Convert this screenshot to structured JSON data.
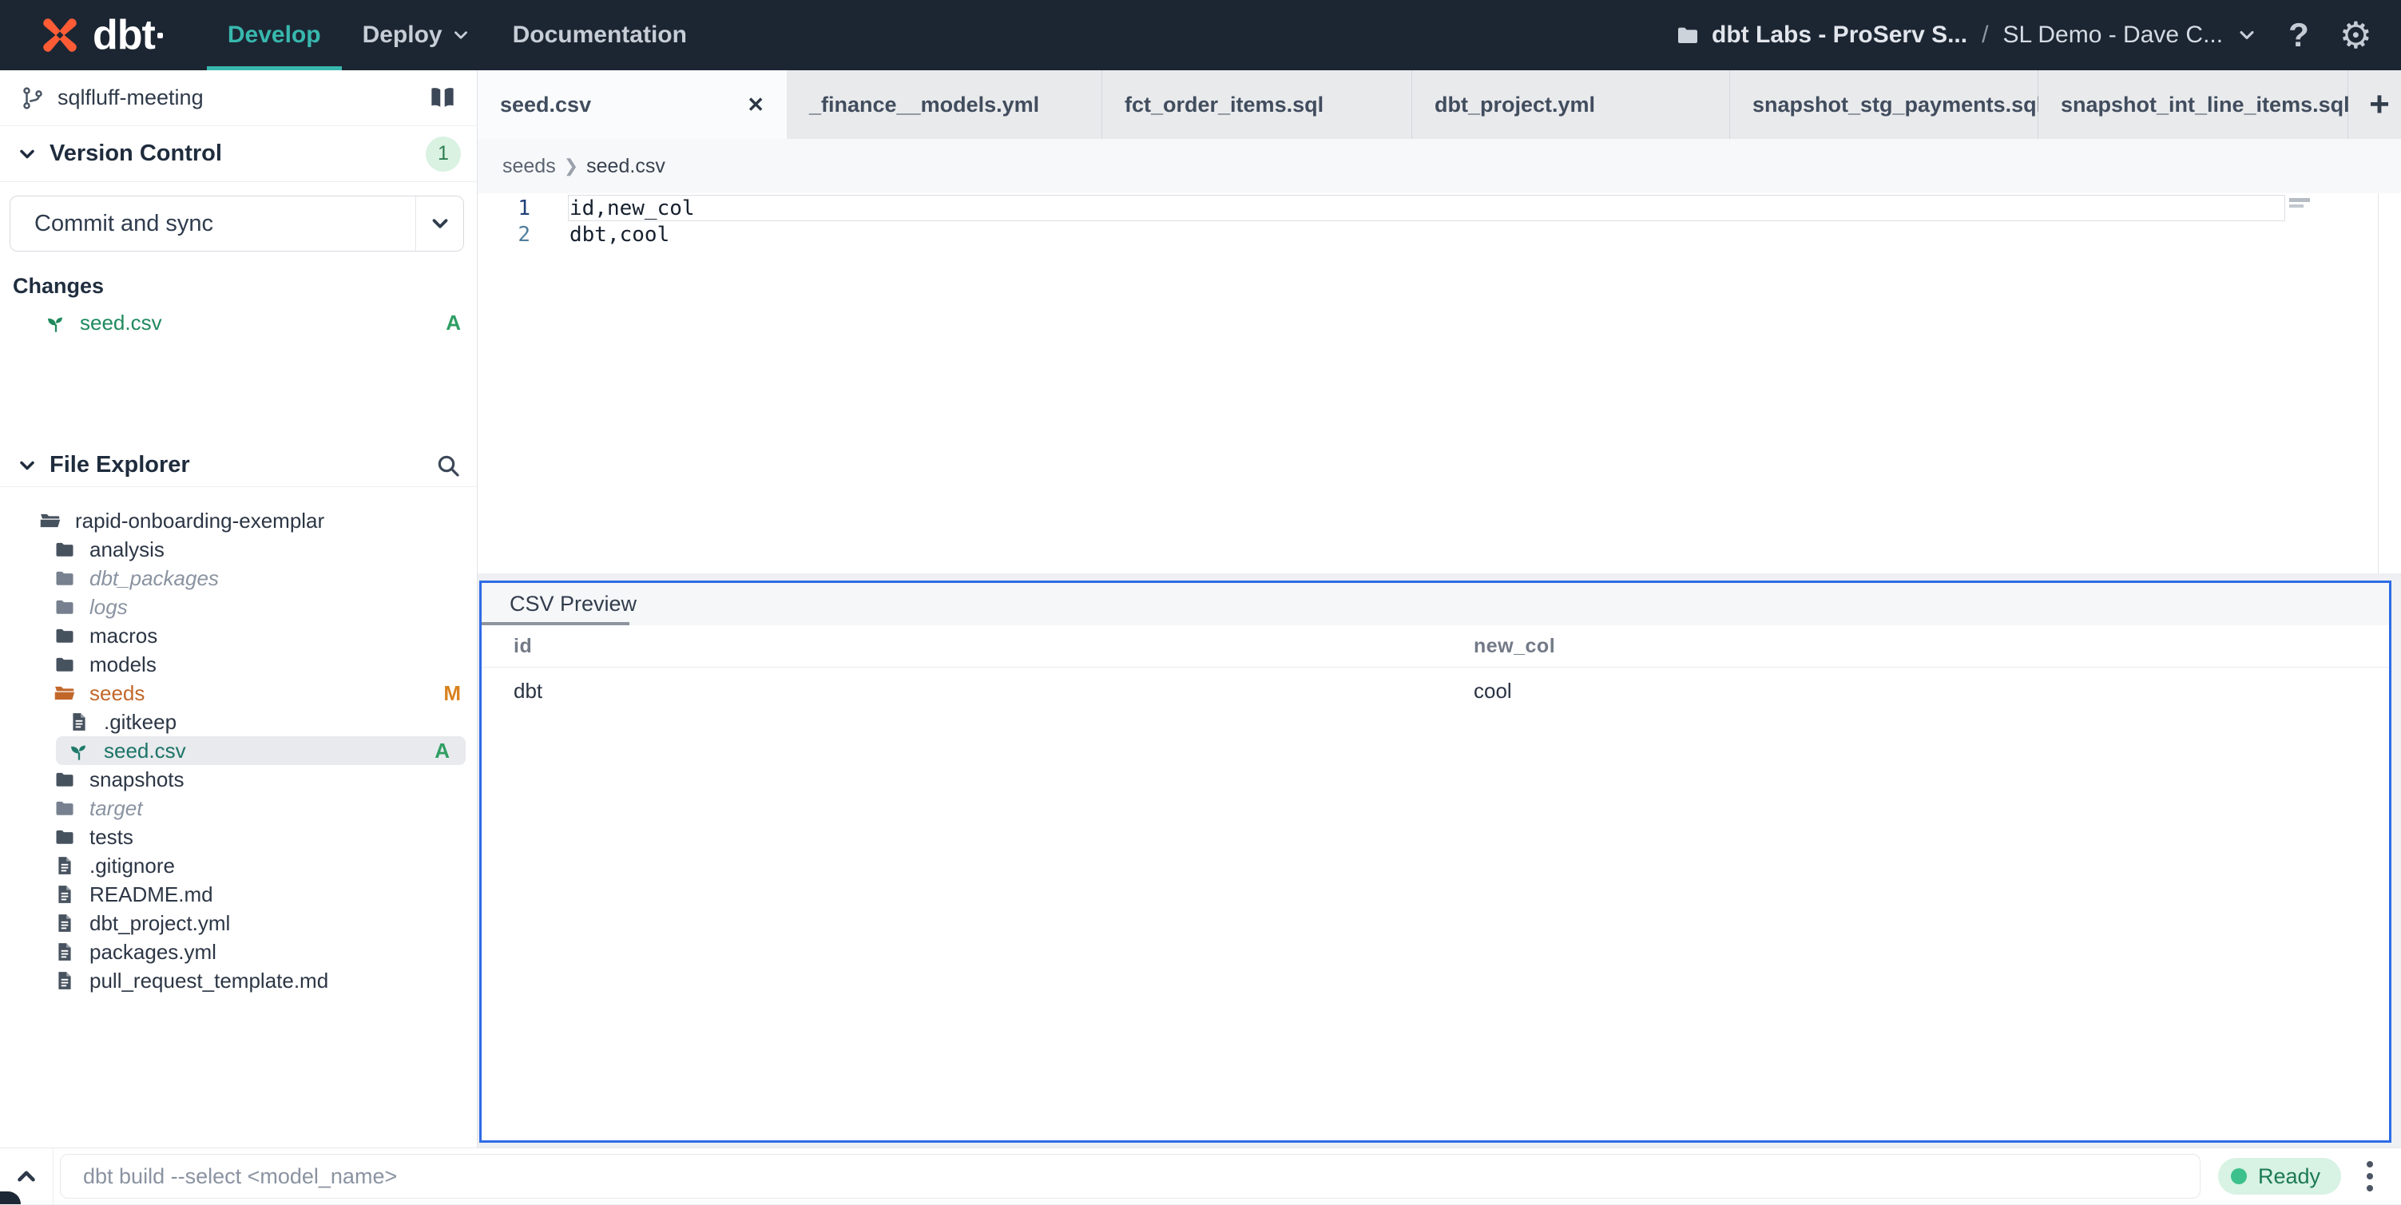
{
  "header": {
    "brand": "dbt",
    "nav_develop": "Develop",
    "nav_deploy": "Deploy",
    "nav_documentation": "Documentation",
    "account_org": "dbt Labs - ProServ S...",
    "account_sep": "/",
    "account_project": "SL Demo - Dave C...",
    "help_label": "?"
  },
  "sidebar": {
    "branch_name": "sqlfluff-meeting",
    "version_control": {
      "title": "Version Control",
      "badge": "1",
      "commit_button": "Commit and sync",
      "changes_label": "Changes",
      "change_file": "seed.csv",
      "change_status": "A"
    },
    "file_explorer": {
      "title": "File Explorer",
      "tree": [
        {
          "name": "rapid-onboarding-exemplar"
        },
        {
          "name": "analysis"
        },
        {
          "name": "dbt_packages"
        },
        {
          "name": "logs"
        },
        {
          "name": "macros"
        },
        {
          "name": "models"
        },
        {
          "name": "seeds",
          "badge": "M"
        },
        {
          "name": ".gitkeep"
        },
        {
          "name": "seed.csv",
          "badge": "A"
        },
        {
          "name": "snapshots"
        },
        {
          "name": "target"
        },
        {
          "name": "tests"
        },
        {
          "name": ".gitignore"
        },
        {
          "name": "README.md"
        },
        {
          "name": "dbt_project.yml"
        },
        {
          "name": "packages.yml"
        },
        {
          "name": "pull_request_template.md"
        }
      ]
    }
  },
  "tabs": [
    {
      "label": "seed.csv",
      "close": "✕"
    },
    {
      "label": "_finance__models.yml"
    },
    {
      "label": "fct_order_items.sql"
    },
    {
      "label": "dbt_project.yml"
    },
    {
      "label": "snapshot_stg_payments.sql"
    },
    {
      "label": "snapshot_int_line_items.sql"
    }
  ],
  "tab_add": "+",
  "editor": {
    "breadcrumb_folder": "seeds",
    "breadcrumb_sep": "❯",
    "breadcrumb_file": "seed.csv",
    "lines": [
      {
        "num": "1",
        "text": "id,new_col"
      },
      {
        "num": "2",
        "text": "dbt,cool"
      }
    ]
  },
  "csv_preview": {
    "title": "CSV Preview",
    "columns": [
      "id",
      "new_col"
    ],
    "rows": [
      [
        "dbt",
        "cool"
      ]
    ]
  },
  "bottom_bar": {
    "command_placeholder": "dbt build --select <model_name>",
    "status": "Ready"
  },
  "colors": {
    "accent_teal": "#38b8ae",
    "brand_orange": "#ff5c35",
    "focus_blue": "#2e6be6",
    "added_green": "#2f9e63",
    "modified_orange": "#d9821f",
    "ready_green": "#3cc08c",
    "topbar_navy": "#1c2633"
  }
}
